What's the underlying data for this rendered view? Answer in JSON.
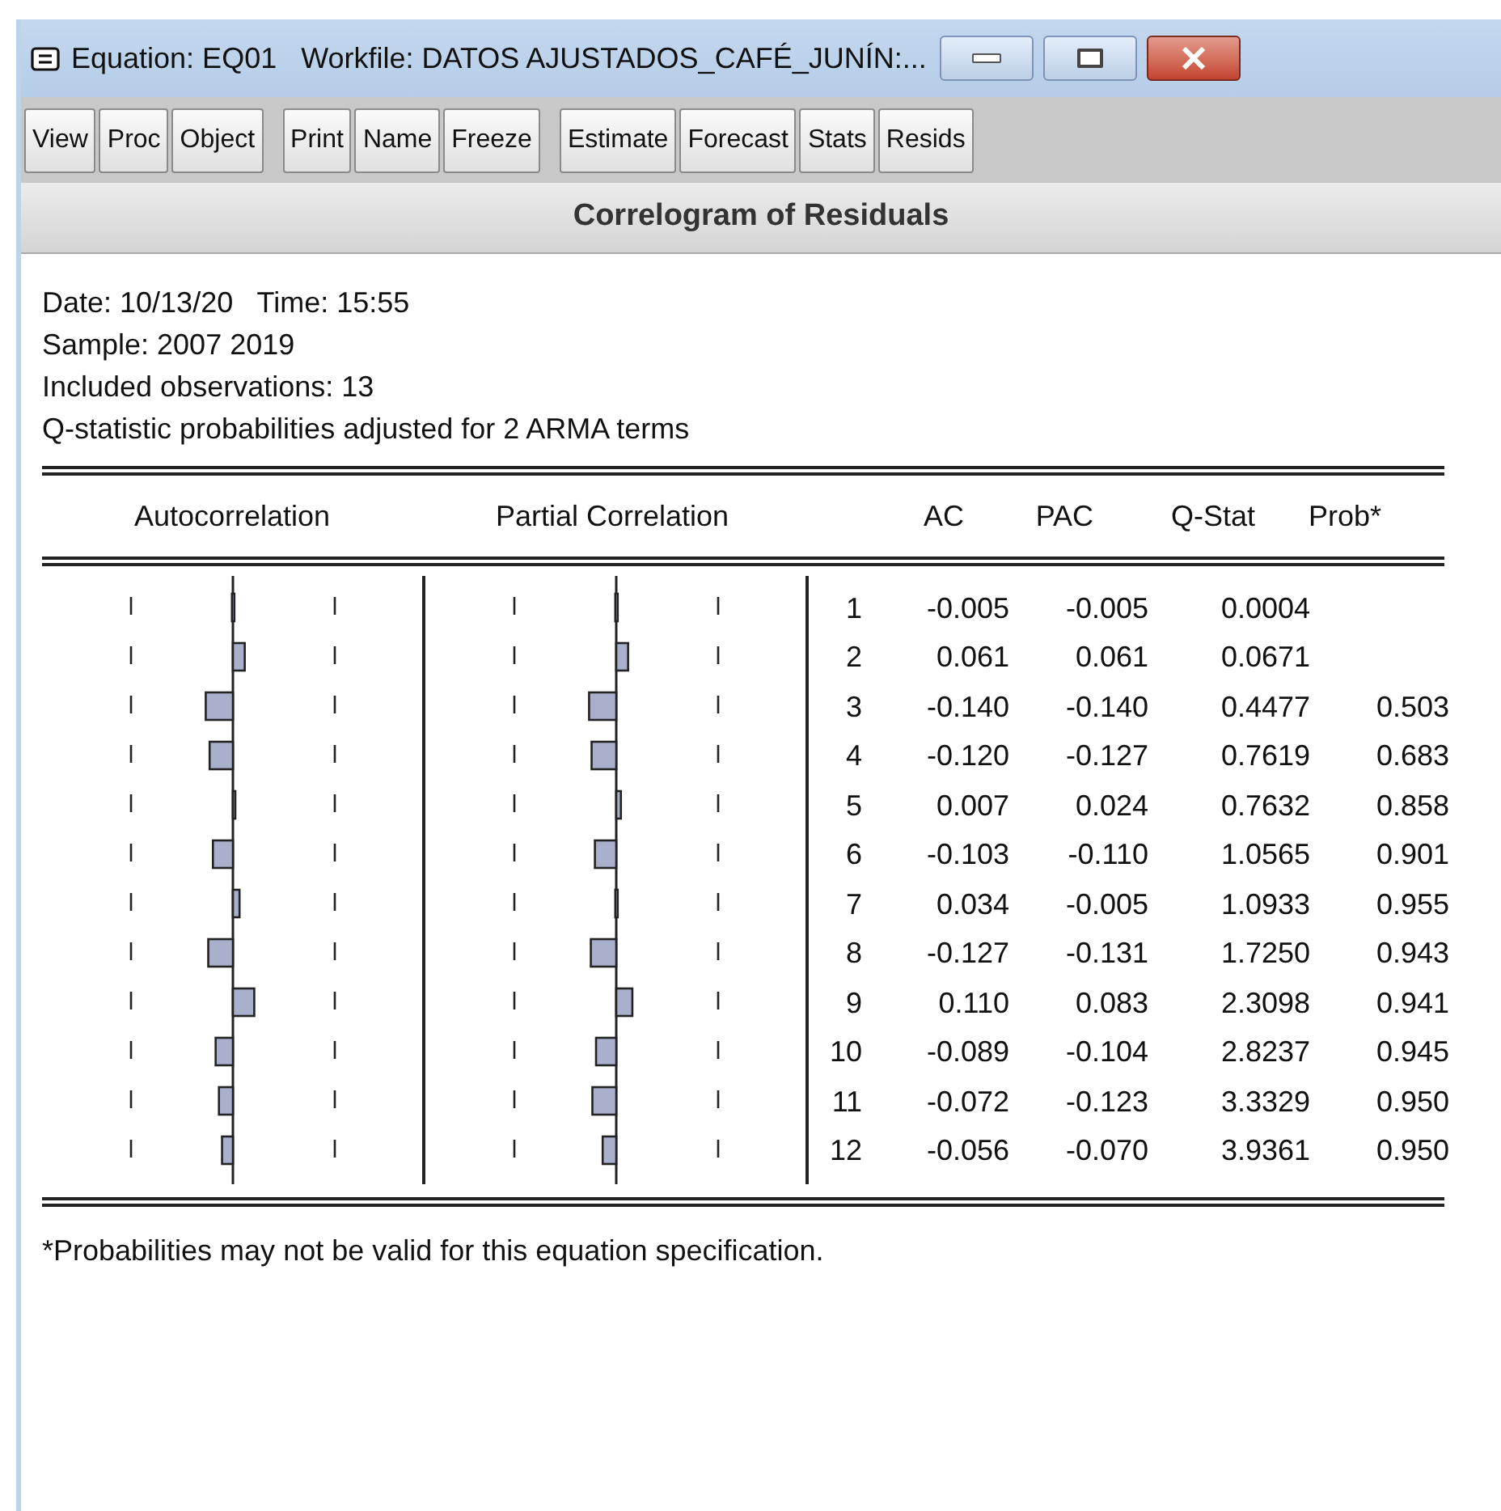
{
  "window": {
    "title": "Equation: EQ01   Workfile: DATOS AJUSTADOS_CAFÉ_JUNÍN:..."
  },
  "toolbar": {
    "groups": [
      [
        "View",
        "Proc",
        "Object"
      ],
      [
        "Print",
        "Name",
        "Freeze"
      ],
      [
        "Estimate",
        "Forecast",
        "Stats",
        "Resids"
      ]
    ]
  },
  "view_title": "Correlogram of Residuals",
  "info": [
    "Date: 10/13/20   Time: 15:55",
    "Sample: 2007 2019",
    "Included observations: 13",
    "Q-statistic probabilities adjusted for 2 ARMA terms"
  ],
  "table": {
    "columns": [
      "Autocorrelation",
      "Partial Correlation",
      "AC",
      "PAC",
      "Q-Stat",
      "Prob*"
    ],
    "rows": [
      {
        "lag": "1",
        "ac": "-0.005",
        "pac": "-0.005",
        "q_stat": "0.0004"
      },
      {
        "lag": "2",
        "ac": "0.061",
        "pac": "0.061",
        "q_stat": "0.0671"
      },
      {
        "lag": "3",
        "ac": "-0.140",
        "pac": "-0.140",
        "q_stat": "0.4477",
        "prob": "0.503"
      },
      {
        "lag": "4",
        "ac": "-0.120",
        "pac": "-0.127",
        "q_stat": "0.7619",
        "prob": "0.683"
      },
      {
        "lag": "5",
        "ac": "0.007",
        "pac": "0.024",
        "q_stat": "0.7632",
        "prob": "0.858"
      },
      {
        "lag": "6",
        "ac": "-0.103",
        "pac": "-0.110",
        "q_stat": "1.0565",
        "prob": "0.901"
      },
      {
        "lag": "7",
        "ac": "0.034",
        "pac": "-0.005",
        "q_stat": "1.0933",
        "prob": "0.955"
      },
      {
        "lag": "8",
        "ac": "-0.127",
        "pac": "-0.131",
        "q_stat": "1.7250",
        "prob": "0.943"
      },
      {
        "lag": "9",
        "ac": "0.110",
        "pac": "0.083",
        "q_stat": "2.3098",
        "prob": "0.941"
      },
      {
        "lag": "10",
        "ac": "-0.089",
        "pac": "-0.104",
        "q_stat": "2.8237",
        "prob": "0.945"
      },
      {
        "lag": "11",
        "ac": "-0.072",
        "pac": "-0.123",
        "q_stat": "3.3329",
        "prob": "0.950"
      },
      {
        "lag": "12",
        "ac": "-0.056",
        "pac": "-0.070",
        "q_stat": "3.9361",
        "prob": "0.950"
      }
    ]
  },
  "footnote": "*Probabilities may not be valid for this equation specification."
}
